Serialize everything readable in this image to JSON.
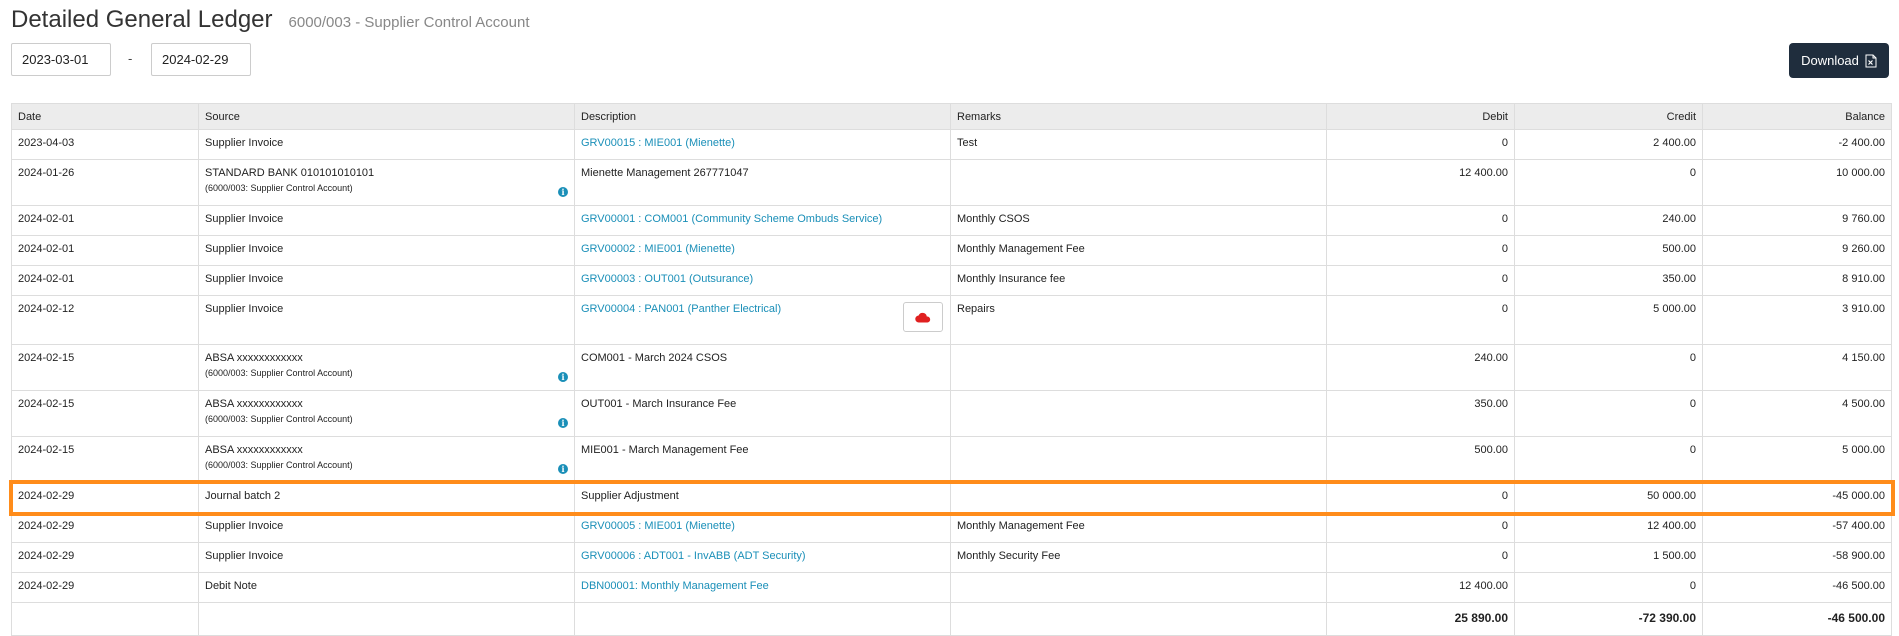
{
  "header": {
    "title": "Detailed General Ledger",
    "subtitle": "6000/003 - Supplier Control Account"
  },
  "filters": {
    "date_from": "2023-03-01",
    "separator": "-",
    "date_to": "2024-02-29"
  },
  "download_label": "Download",
  "columns": {
    "date": "Date",
    "source": "Source",
    "description": "Description",
    "remarks": "Remarks",
    "debit": "Debit",
    "credit": "Credit",
    "balance": "Balance"
  },
  "rows": [
    {
      "date": "2023-04-03",
      "source": "Supplier Invoice",
      "description": "GRV00015 : MIE001 (Mienette)",
      "remarks": "Test",
      "debit": "0",
      "credit": "2 400.00",
      "balance": "-2 400.00"
    },
    {
      "date": "2024-01-26",
      "source": "STANDARD BANK 010101010101",
      "source_sub": "(6000/003: Supplier Control Account)",
      "description": "Mienette Management 267771047",
      "remarks": "",
      "debit": "12 400.00",
      "credit": "0",
      "balance": "10 000.00"
    },
    {
      "date": "2024-02-01",
      "source": "Supplier Invoice",
      "description": "GRV00001 : COM001 (Community Scheme Ombuds Service)",
      "remarks": "Monthly CSOS",
      "debit": "0",
      "credit": "240.00",
      "balance": "9 760.00"
    },
    {
      "date": "2024-02-01",
      "source": "Supplier Invoice",
      "description": "GRV00002 : MIE001 (Mienette)",
      "remarks": "Monthly Management Fee",
      "debit": "0",
      "credit": "500.00",
      "balance": "9 260.00"
    },
    {
      "date": "2024-02-01",
      "source": "Supplier Invoice",
      "description": "GRV00003 : OUT001 (Outsurance)",
      "remarks": "Monthly Insurance fee",
      "debit": "0",
      "credit": "350.00",
      "balance": "8 910.00"
    },
    {
      "date": "2024-02-12",
      "source": "Supplier Invoice",
      "description": "GRV00004 : PAN001 (Panther Electrical)",
      "remarks": "Repairs",
      "debit": "0",
      "credit": "5 000.00",
      "balance": "3 910.00"
    },
    {
      "date": "2024-02-15",
      "source": "ABSA xxxxxxxxxxxx",
      "source_sub": "(6000/003: Supplier Control Account)",
      "description": "COM001 - March 2024 CSOS",
      "remarks": "",
      "debit": "240.00",
      "credit": "0",
      "balance": "4 150.00"
    },
    {
      "date": "2024-02-15",
      "source": "ABSA xxxxxxxxxxxx",
      "source_sub": "(6000/003: Supplier Control Account)",
      "description": "OUT001 - March Insurance Fee",
      "remarks": "",
      "debit": "350.00",
      "credit": "0",
      "balance": "4 500.00"
    },
    {
      "date": "2024-02-15",
      "source": "ABSA xxxxxxxxxxxx",
      "source_sub": "(6000/003: Supplier Control Account)",
      "description": "MIE001 - March Management Fee",
      "remarks": "",
      "debit": "500.00",
      "credit": "0",
      "balance": "5 000.00"
    },
    {
      "date": "2024-02-29",
      "source": "Journal batch 2",
      "description": "Supplier Adjustment",
      "remarks": "",
      "debit": "0",
      "credit": "50 000.00",
      "balance": "-45 000.00"
    },
    {
      "date": "2024-02-29",
      "source": "Supplier Invoice",
      "description": "GRV00005 : MIE001 (Mienette)",
      "remarks": "Monthly Management Fee",
      "debit": "0",
      "credit": "12 400.00",
      "balance": "-57 400.00"
    },
    {
      "date": "2024-02-29",
      "source": "Supplier Invoice",
      "description": "GRV00006 : ADT001 - InvABB (ADT Security)",
      "remarks": "Monthly Security Fee",
      "debit": "0",
      "credit": "1 500.00",
      "balance": "-58 900.00"
    },
    {
      "date": "2024-02-29",
      "source": "Debit Note",
      "description": "DBN00001: Monthly Management Fee",
      "remarks": "",
      "debit": "12 400.00",
      "credit": "0",
      "balance": "-46 500.00"
    }
  ],
  "totals": {
    "debit": "25 890.00",
    "credit": "-72 390.00",
    "balance": "-46 500.00"
  },
  "icons": {
    "info": "info-icon",
    "cloud": "cloud-icon",
    "excel": "excel-file-icon"
  },
  "colors": {
    "link": "#1a8fb8",
    "highlight": "#ff8c1a",
    "button_bg": "#1f2d3d",
    "cloud": "#e02020"
  }
}
